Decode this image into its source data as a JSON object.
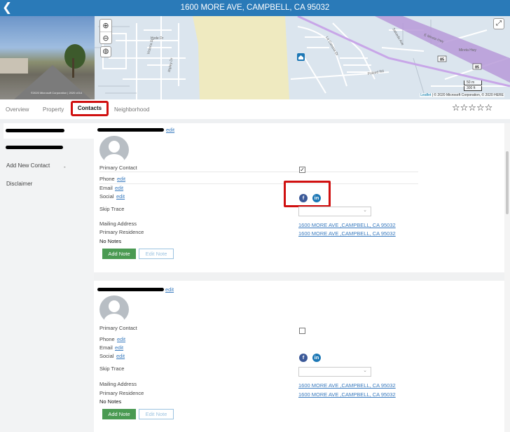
{
  "header": {
    "back_icon": "chevron-left-icon",
    "back_glyph": "❮",
    "title": "1600 MORE AVE, CAMPBELL, CA 95032"
  },
  "streetview": {
    "credit": "©2020 Microsoft Corporation | 2020 c014"
  },
  "map": {
    "zoom_in": "⊕",
    "zoom_out": "⊖",
    "layers_icon": "globe-icon",
    "layers_glyph": "◍",
    "expand_glyph": "⤢",
    "street_labels": [
      "Hyde Dr",
      "Victoria Dr",
      "Ripley Dr",
      "Pollard Rd",
      "La Cozona Dr",
      "E Mireta Hwy",
      "Salcedo Ave",
      "Mireta Hwy"
    ],
    "road_shields": [
      "85",
      "85"
    ],
    "scale": [
      "50 m",
      "300 ft"
    ],
    "attribution_link": "Leaflet",
    "attribution_text": " | © 2020 Microsoft Corporation, © 2020 HERE",
    "colors": {
      "park": "#efeac0",
      "highway": "#b79ad8",
      "land": "#dbe5ee"
    }
  },
  "tabs": [
    {
      "label": "Overview"
    },
    {
      "label": "Property"
    },
    {
      "label": "Contacts"
    },
    {
      "label": "Neighborhood"
    }
  ],
  "rating": {
    "stars": "☆☆☆☆☆",
    "value": 0,
    "max": 5
  },
  "sidebar": {
    "add_contact": "Add New Contact",
    "add_dot": "-",
    "disclaimer": "Disclaimer"
  },
  "contacts": [
    {
      "edit": "edit",
      "primary_contact": "Primary Contact",
      "primary_checked": true,
      "check_glyph": "✓",
      "phone": "Phone",
      "email": "Email",
      "social": "Social",
      "skip_trace": "Skip Trace",
      "mailing_address_label": "Mailing Address",
      "mailing_address": "1600 MORE AVE ,CAMPBELL, CA 95032",
      "primary_residence_label": "Primary Residence",
      "primary_residence": "1600 MORE AVE ,CAMPBELL, CA 95032",
      "notes": "No Notes",
      "add_note": "Add Note",
      "edit_note": "Edit Note"
    },
    {
      "edit": "edit",
      "primary_contact": "Primary Contact",
      "primary_checked": false,
      "check_glyph": "",
      "phone": "Phone",
      "email": "Email",
      "social": "Social",
      "skip_trace": "Skip Trace",
      "mailing_address_label": "Mailing Address",
      "mailing_address": "1600 MORE AVE ,CAMPBELL, CA 95032",
      "primary_residence_label": "Primary Residence",
      "primary_residence": "1600 MORE AVE ,CAMPBELL, CA 95032",
      "notes": "No Notes",
      "add_note": "Add Note",
      "edit_note": "Edit Note"
    }
  ],
  "social_icons": {
    "facebook": "f",
    "linkedin": "in"
  },
  "select_arrow": "⌄",
  "colors": {
    "accent": "#2a7ab8",
    "highlight": "#d01010",
    "add_note": "#4a9a52",
    "facebook": "#3b5998",
    "linkedin": "#1c77b5"
  }
}
